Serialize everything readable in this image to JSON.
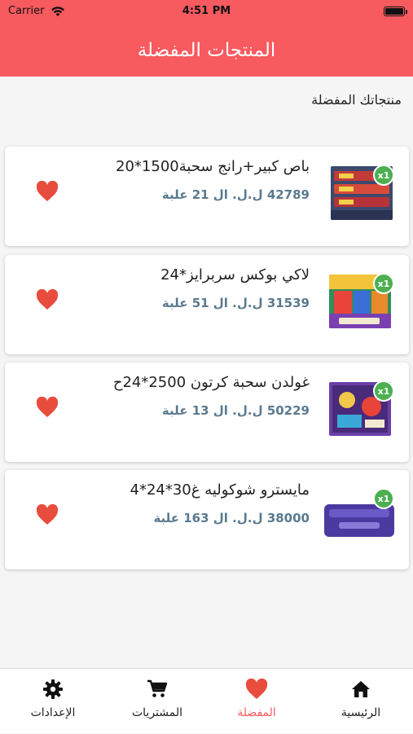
{
  "status_bar": {
    "carrier": "Carrier",
    "time": "4:51 PM"
  },
  "header": {
    "title": "المنتجات المفضلة"
  },
  "subtitle": "منتجاتك المفضلة",
  "products": [
    {
      "name": "باص كبير+رانج سحبة1500*20",
      "price": "42789 ل.ل. ال 21 علبة",
      "qty": "x1"
    },
    {
      "name": "لاكي بوكس سربرايز*24",
      "price": "31539 ل.ل. ال 51 علبة",
      "qty": "x1"
    },
    {
      "name": "غولدن سحبة كرتون 2500*24ح",
      "price": "50229 ل.ل. ال 13 علبة",
      "qty": "x1"
    },
    {
      "name": "مايسترو شوكوليه غ30*24*4",
      "price": "38000 ل.ل. ال 163 علبة",
      "qty": "x1"
    }
  ],
  "tabs": [
    {
      "label": "الرئيسية",
      "icon": "home-icon"
    },
    {
      "label": "المفضلة",
      "icon": "heart-icon"
    },
    {
      "label": "المشتريات",
      "icon": "cart-icon"
    },
    {
      "label": "الإعدادات",
      "icon": "gear-icon"
    }
  ],
  "colors": {
    "accent": "#f75a5f",
    "badge": "#4caf50",
    "price": "#5a7a8f",
    "heart": "#e84c3d"
  }
}
